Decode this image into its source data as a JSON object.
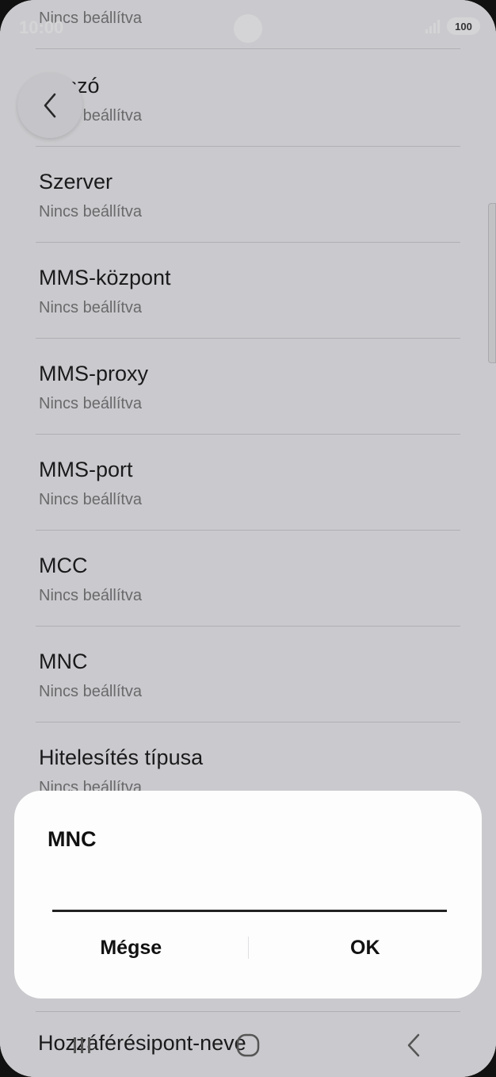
{
  "status_bar": {
    "time": "10:00",
    "battery": "100"
  },
  "list": {
    "items": [
      {
        "title": "Jelszó",
        "subtitle": "Nincs beállítva"
      },
      {
        "title": "Szerver",
        "subtitle": "Nincs beállítva"
      },
      {
        "title": "MMS-központ",
        "subtitle": "Nincs beállítva"
      },
      {
        "title": "MMS-proxy",
        "subtitle": "Nincs beállítva"
      },
      {
        "title": "MMS-port",
        "subtitle": "Nincs beállítva"
      },
      {
        "title": "MCC",
        "subtitle": "Nincs beállítva"
      },
      {
        "title": "MNC",
        "subtitle": "Nincs beállítva"
      },
      {
        "title": "Hitelesítés típusa",
        "subtitle": "Nincs beállítva"
      }
    ],
    "top_partial_subtitle": "Nincs beállítva",
    "bottom_partial_title": "Hozzáférésipont-neve"
  },
  "dialog": {
    "title": "MNC",
    "input_value": "",
    "cancel_label": "Mégse",
    "ok_label": "OK"
  }
}
